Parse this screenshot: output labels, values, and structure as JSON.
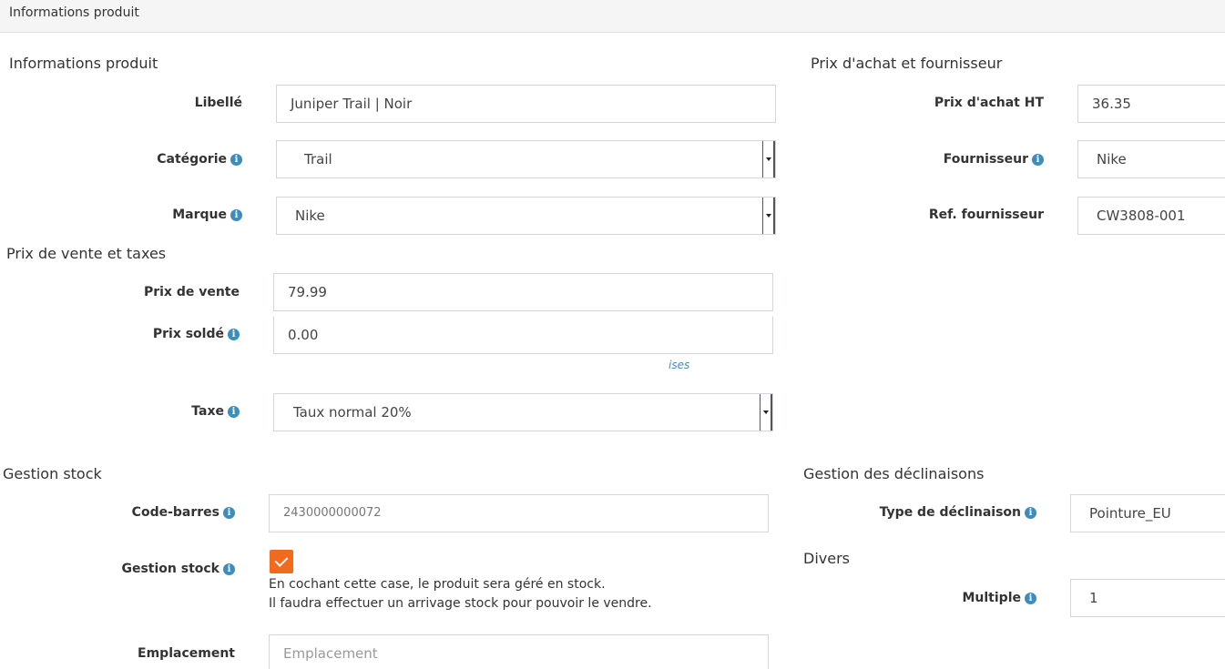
{
  "panel": {
    "title": "Informations produit"
  },
  "sections": {
    "product_info": "Informations produit",
    "purchase_supplier": "Prix d'achat et fournisseur",
    "sale_price_taxes": "Prix de vente et taxes",
    "stock": "Gestion stock",
    "variants": "Gestion des déclinaisons",
    "misc": "Divers"
  },
  "fields": {
    "label": {
      "label": "Libellé",
      "value": "Juniper Trail | Noir"
    },
    "category": {
      "label": "Catégorie",
      "value": "Trail"
    },
    "brand": {
      "label": "Marque",
      "value": "Nike"
    },
    "purchase_price": {
      "label": "Prix d'achat HT",
      "value": "36.35"
    },
    "supplier": {
      "label": "Fournisseur",
      "value": "Nike"
    },
    "supplier_ref": {
      "label": "Ref. fournisseur",
      "value": "CW3808-001"
    },
    "sale_price": {
      "label": "Prix de vente",
      "value": "79.99"
    },
    "sale_discount": {
      "label": "Prix soldé",
      "value": "0.00"
    },
    "tax": {
      "label": "Taxe",
      "value": "Taux normal 20%"
    },
    "barcode": {
      "label": "Code-barres",
      "value": "2430000000072"
    },
    "stock_mgmt": {
      "label": "Gestion stock",
      "checked": true,
      "help_line1": "En cochant cette case, le produit sera géré en stock.",
      "help_line2": "Il faudra effectuer un arrivage stock pour pouvoir le vendre."
    },
    "location": {
      "label": "Emplacement",
      "placeholder": "Emplacement"
    },
    "variant_type": {
      "label": "Type de déclinaison",
      "value": "Pointure_EU"
    },
    "multiple": {
      "label": "Multiple",
      "value": "1"
    }
  },
  "fragments": {
    "italic_link": "ises"
  },
  "icons": {
    "info": "info-circle-icon"
  },
  "colors": {
    "accent": "#3c8dbc",
    "checkbox": "#f26a1b"
  }
}
